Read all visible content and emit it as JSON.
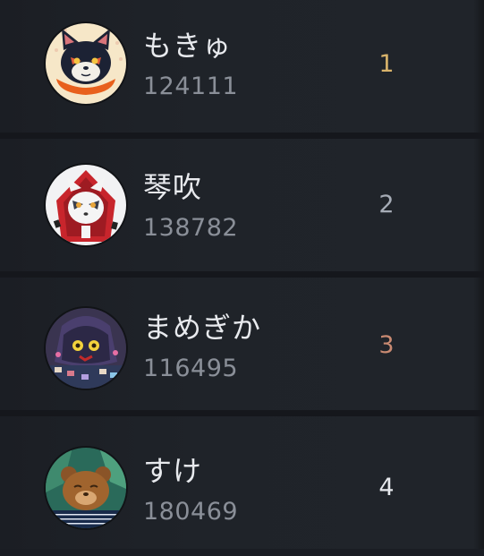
{
  "leaderboard": {
    "entries": [
      {
        "name": "もきゅ",
        "score": "124111",
        "rank": "1",
        "rank_color": "#d9b36b",
        "avatar": "fox-character-avatar"
      },
      {
        "name": "琴吹",
        "score": "138782",
        "rank": "2",
        "rank_color": "#a6acb6",
        "avatar": "hooded-fox-character-avatar"
      },
      {
        "name": "まめぎか",
        "score": "116495",
        "rank": "3",
        "rank_color": "#c98a72",
        "avatar": "ghost-creature-avatar"
      },
      {
        "name": "すけ",
        "score": "180469",
        "rank": "4",
        "rank_color": "#e6e8ec",
        "avatar": "bear-character-avatar"
      }
    ]
  }
}
